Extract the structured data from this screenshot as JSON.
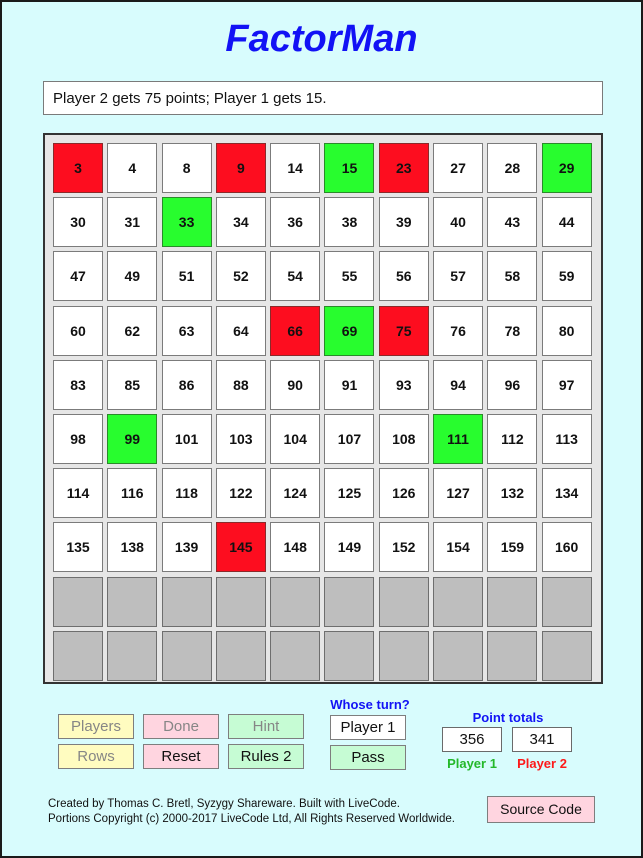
{
  "app": {
    "title": "FactorMan",
    "message": "Player 2 gets 75 points; Player 1 gets 15."
  },
  "colors": {
    "background": "#d8fcfd",
    "title": "#1212f5",
    "player1_claimed": "#28fd2e",
    "player2_claimed": "#fd0d1f",
    "empty_tile": "#bebebe"
  },
  "board": {
    "columns": 10,
    "tiles": [
      {
        "n": "3",
        "s": "red"
      },
      {
        "n": "4",
        "s": "open"
      },
      {
        "n": "8",
        "s": "open"
      },
      {
        "n": "9",
        "s": "red"
      },
      {
        "n": "14",
        "s": "open"
      },
      {
        "n": "15",
        "s": "green"
      },
      {
        "n": "23",
        "s": "red"
      },
      {
        "n": "27",
        "s": "open"
      },
      {
        "n": "28",
        "s": "open"
      },
      {
        "n": "29",
        "s": "green"
      },
      {
        "n": "30",
        "s": "open"
      },
      {
        "n": "31",
        "s": "open"
      },
      {
        "n": "33",
        "s": "green"
      },
      {
        "n": "34",
        "s": "open"
      },
      {
        "n": "36",
        "s": "open"
      },
      {
        "n": "38",
        "s": "open"
      },
      {
        "n": "39",
        "s": "open"
      },
      {
        "n": "40",
        "s": "open"
      },
      {
        "n": "43",
        "s": "open"
      },
      {
        "n": "44",
        "s": "open"
      },
      {
        "n": "47",
        "s": "open"
      },
      {
        "n": "49",
        "s": "open"
      },
      {
        "n": "51",
        "s": "open"
      },
      {
        "n": "52",
        "s": "open"
      },
      {
        "n": "54",
        "s": "open"
      },
      {
        "n": "55",
        "s": "open"
      },
      {
        "n": "56",
        "s": "open"
      },
      {
        "n": "57",
        "s": "open"
      },
      {
        "n": "58",
        "s": "open"
      },
      {
        "n": "59",
        "s": "open"
      },
      {
        "n": "60",
        "s": "open"
      },
      {
        "n": "62",
        "s": "open"
      },
      {
        "n": "63",
        "s": "open"
      },
      {
        "n": "64",
        "s": "open"
      },
      {
        "n": "66",
        "s": "red"
      },
      {
        "n": "69",
        "s": "green"
      },
      {
        "n": "75",
        "s": "red"
      },
      {
        "n": "76",
        "s": "open"
      },
      {
        "n": "78",
        "s": "open"
      },
      {
        "n": "80",
        "s": "open"
      },
      {
        "n": "83",
        "s": "open"
      },
      {
        "n": "85",
        "s": "open"
      },
      {
        "n": "86",
        "s": "open"
      },
      {
        "n": "88",
        "s": "open"
      },
      {
        "n": "90",
        "s": "open"
      },
      {
        "n": "91",
        "s": "open"
      },
      {
        "n": "93",
        "s": "open"
      },
      {
        "n": "94",
        "s": "open"
      },
      {
        "n": "96",
        "s": "open"
      },
      {
        "n": "97",
        "s": "open"
      },
      {
        "n": "98",
        "s": "open"
      },
      {
        "n": "99",
        "s": "green"
      },
      {
        "n": "101",
        "s": "open"
      },
      {
        "n": "103",
        "s": "open"
      },
      {
        "n": "104",
        "s": "open"
      },
      {
        "n": "107",
        "s": "open"
      },
      {
        "n": "108",
        "s": "open"
      },
      {
        "n": "111",
        "s": "green"
      },
      {
        "n": "112",
        "s": "open"
      },
      {
        "n": "113",
        "s": "open"
      },
      {
        "n": "114",
        "s": "open"
      },
      {
        "n": "116",
        "s": "open"
      },
      {
        "n": "118",
        "s": "open"
      },
      {
        "n": "122",
        "s": "open"
      },
      {
        "n": "124",
        "s": "open"
      },
      {
        "n": "125",
        "s": "open"
      },
      {
        "n": "126",
        "s": "open"
      },
      {
        "n": "127",
        "s": "open"
      },
      {
        "n": "132",
        "s": "open"
      },
      {
        "n": "134",
        "s": "open"
      },
      {
        "n": "135",
        "s": "open"
      },
      {
        "n": "138",
        "s": "open"
      },
      {
        "n": "139",
        "s": "open"
      },
      {
        "n": "145",
        "s": "red"
      },
      {
        "n": "148",
        "s": "open"
      },
      {
        "n": "149",
        "s": "open"
      },
      {
        "n": "152",
        "s": "open"
      },
      {
        "n": "154",
        "s": "open"
      },
      {
        "n": "159",
        "s": "open"
      },
      {
        "n": "160",
        "s": "open"
      },
      {
        "n": "",
        "s": "empty"
      },
      {
        "n": "",
        "s": "empty"
      },
      {
        "n": "",
        "s": "empty"
      },
      {
        "n": "",
        "s": "empty"
      },
      {
        "n": "",
        "s": "empty"
      },
      {
        "n": "",
        "s": "empty"
      },
      {
        "n": "",
        "s": "empty"
      },
      {
        "n": "",
        "s": "empty"
      },
      {
        "n": "",
        "s": "empty"
      },
      {
        "n": "",
        "s": "empty"
      },
      {
        "n": "",
        "s": "empty"
      },
      {
        "n": "",
        "s": "empty"
      },
      {
        "n": "",
        "s": "empty"
      },
      {
        "n": "",
        "s": "empty"
      },
      {
        "n": "",
        "s": "empty"
      },
      {
        "n": "",
        "s": "empty"
      },
      {
        "n": "",
        "s": "empty"
      },
      {
        "n": "",
        "s": "empty"
      },
      {
        "n": "",
        "s": "empty"
      },
      {
        "n": "",
        "s": "empty"
      }
    ]
  },
  "controls": {
    "players": {
      "label": "Players",
      "enabled": false
    },
    "done": {
      "label": "Done",
      "enabled": false
    },
    "hint": {
      "label": "Hint",
      "enabled": false
    },
    "rows": {
      "label": "Rows",
      "enabled": false
    },
    "reset": {
      "label": "Reset",
      "enabled": true
    },
    "rules": {
      "label": "Rules 2",
      "enabled": true
    },
    "pass": {
      "label": "Pass",
      "enabled": true
    }
  },
  "turn": {
    "heading": "Whose turn?",
    "current": "Player 1"
  },
  "scores": {
    "heading": "Point totals",
    "player1": {
      "label": "Player 1",
      "value": "356",
      "color": "#24b82a"
    },
    "player2": {
      "label": "Player 2",
      "value": "341",
      "color": "#fd1a1a"
    }
  },
  "footer": {
    "line1": "Created by Thomas C. Bretl, Syzygy Shareware.  Built with LiveCode.",
    "line2": "Portions Copyright (c) 2000-2017 LiveCode Ltd, All Rights Reserved Worldwide.",
    "source_code_label": "Source Code"
  }
}
